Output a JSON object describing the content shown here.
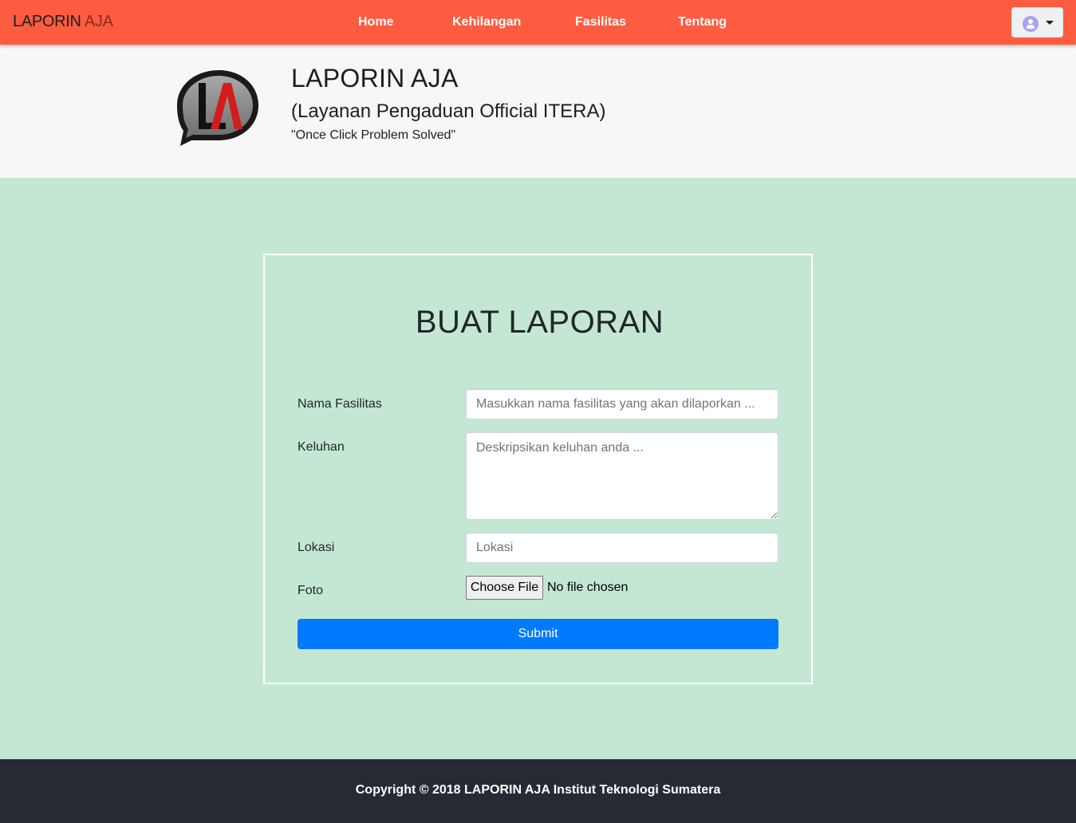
{
  "navbar": {
    "brand_part1": "LAPORIN",
    "brand_part2": "AJA",
    "links": [
      "Home",
      "Kehilangan",
      "Fasilitas",
      "Tentang"
    ]
  },
  "header": {
    "logo_letters": "LA",
    "title": "LAPORIN AJA",
    "subtitle": "(Layanan Pengaduan Official ITERA)",
    "tagline": "\"Once Click Problem Solved\""
  },
  "form": {
    "title": "BUAT LAPORAN",
    "fields": {
      "nama_fasilitas": {
        "label": "Nama Fasilitas",
        "placeholder": "Masukkan nama fasilitas yang akan dilaporkan ...",
        "value": ""
      },
      "keluhan": {
        "label": "Keluhan",
        "placeholder": "Deskripsikan keluhan anda ...",
        "value": ""
      },
      "lokasi": {
        "label": "Lokasi",
        "placeholder": "Lokasi",
        "value": ""
      },
      "foto": {
        "label": "Foto",
        "button_label": "Choose File",
        "status": "No file chosen"
      }
    },
    "submit_label": "Submit"
  },
  "footer": {
    "text": "Copyright © 2018 LAPORIN AJA Institut Teknologi Sumatera"
  },
  "colors": {
    "navbar": "#fd5c41",
    "page_bg": "#c4e7d4",
    "header_bg": "#f7f7f7",
    "primary": "#007bff",
    "footer_bg": "#262b33"
  },
  "icons": {
    "user_menu": "user-avatar-icon",
    "dropdown": "caret-down-icon"
  }
}
